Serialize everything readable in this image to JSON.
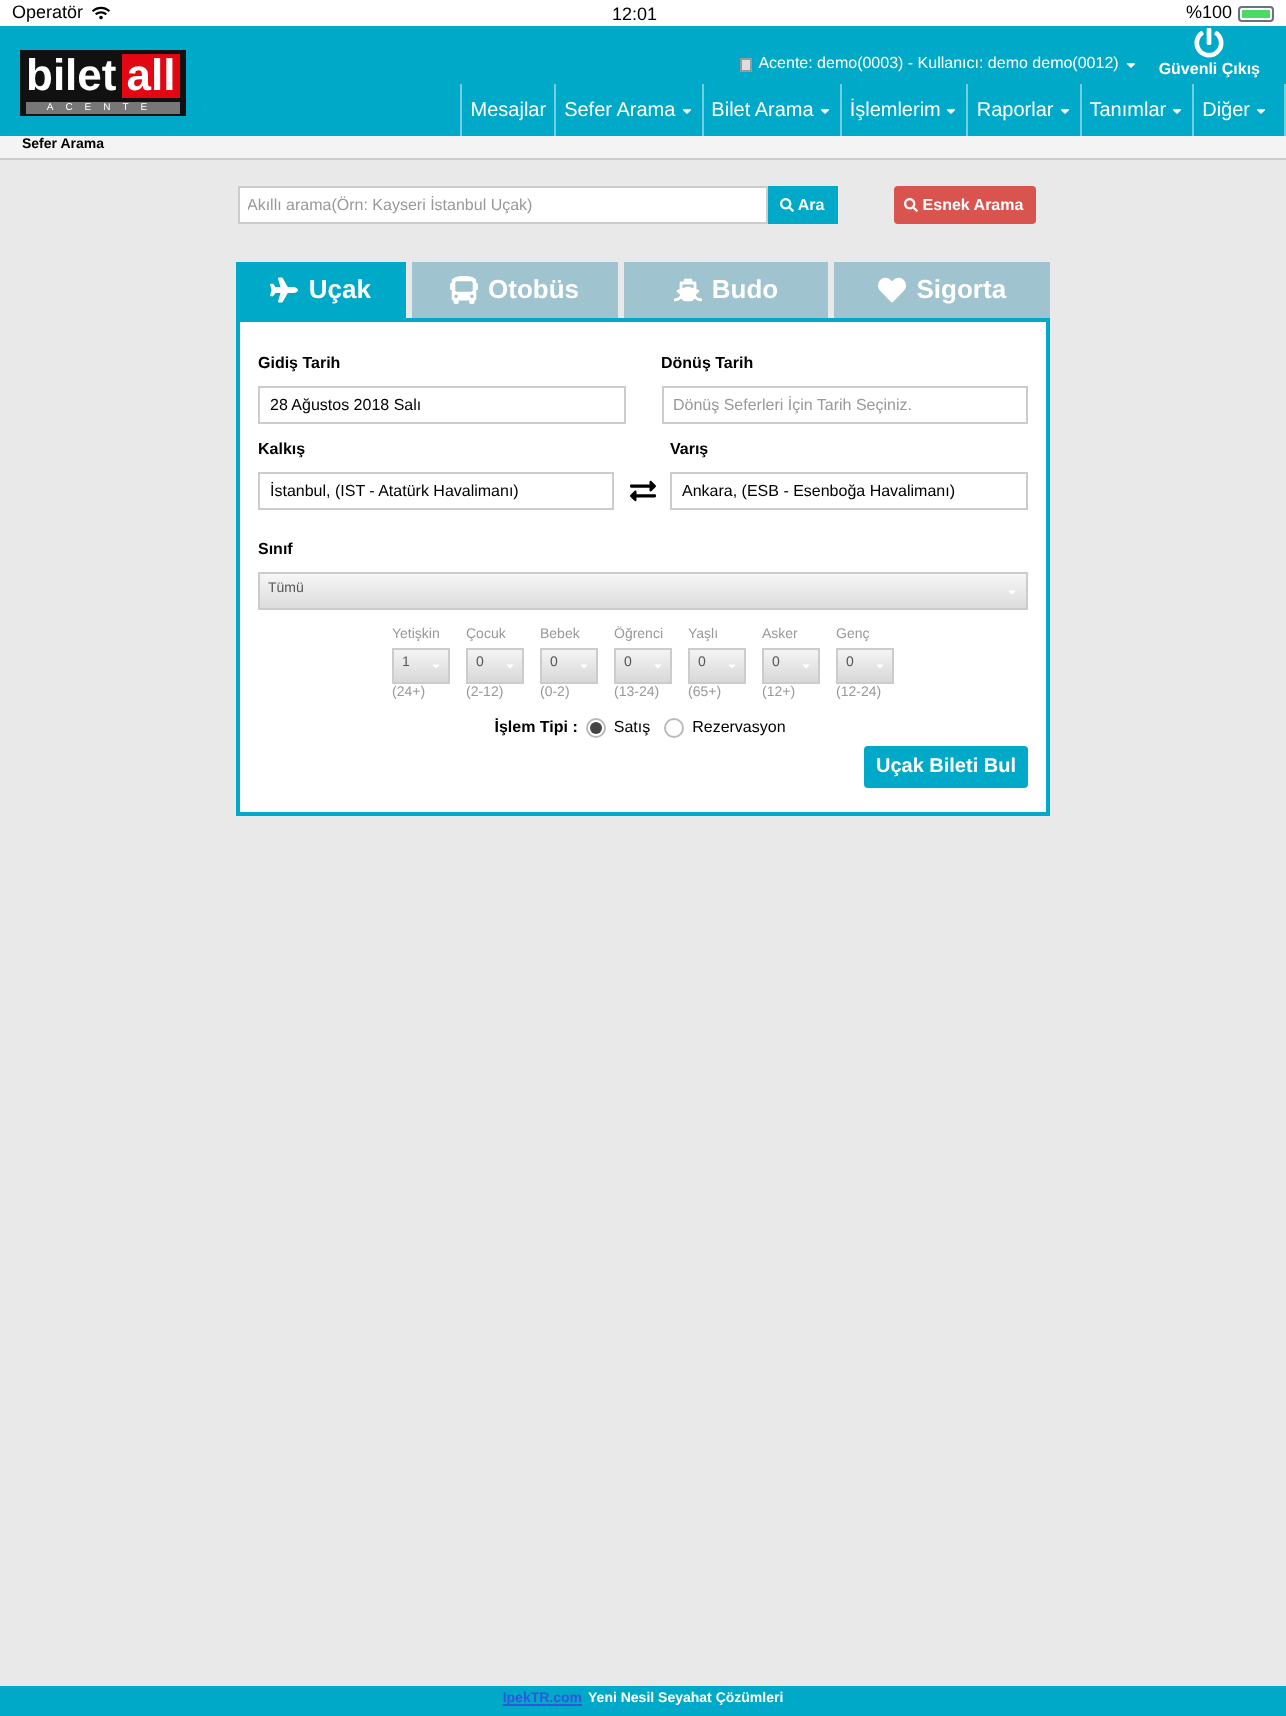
{
  "status_bar": {
    "carrier": "Operatör",
    "time": "12:01",
    "battery": "%100"
  },
  "header": {
    "logo": {
      "left": "bilet",
      "right": "all",
      "sub": "ACENTE"
    },
    "user_info": "Acente: demo(0003) - Kullanıcı: demo demo(0012)",
    "logout": "Güvenli Çıkış",
    "nav": [
      {
        "label": "Mesajlar",
        "dropdown": false
      },
      {
        "label": "Sefer Arama",
        "dropdown": true
      },
      {
        "label": "Bilet Arama",
        "dropdown": true
      },
      {
        "label": "İşlemlerim",
        "dropdown": true
      },
      {
        "label": "Raporlar",
        "dropdown": true
      },
      {
        "label": "Tanımlar",
        "dropdown": true
      },
      {
        "label": "Diğer",
        "dropdown": true
      }
    ]
  },
  "breadcrumb": "Sefer Arama",
  "search": {
    "placeholder": "Akıllı arama(Örn: Kayseri İstanbul Uçak)",
    "button": "Ara",
    "flex_button": "Esnek Arama"
  },
  "tabs": [
    {
      "label": "Uçak",
      "kind": "plane",
      "selected": true
    },
    {
      "label": "Otobüs",
      "kind": "bus",
      "selected": false
    },
    {
      "label": "Budo",
      "kind": "ship",
      "selected": false
    },
    {
      "label": "Sigorta",
      "kind": "heart",
      "selected": false
    }
  ],
  "form": {
    "departure_date": {
      "label": "Gidiş Tarih",
      "value": "28 Ağustos 2018 Salı"
    },
    "return_date": {
      "label": "Dönüş Tarih",
      "placeholder": "Dönüş Seferleri İçin Tarih Seçiniz."
    },
    "from": {
      "label": "Kalkış",
      "value": "İstanbul, (IST - Atatürk Havalimanı)"
    },
    "to": {
      "label": "Varış",
      "value": "Ankara, (ESB - Esenboğa Havalimanı)"
    },
    "class": {
      "label": "Sınıf",
      "value": "Tümü"
    },
    "passengers": [
      {
        "label": "Yetişkin",
        "value": "1",
        "range": "(24+)"
      },
      {
        "label": "Çocuk",
        "value": "0",
        "range": "(2-12)"
      },
      {
        "label": "Bebek",
        "value": "0",
        "range": "(0-2)"
      },
      {
        "label": "Öğrenci",
        "value": "0",
        "range": "(13-24)"
      },
      {
        "label": "Yaşlı",
        "value": "0",
        "range": "(65+)"
      },
      {
        "label": "Asker",
        "value": "0",
        "range": "(12+)"
      },
      {
        "label": "Genç",
        "value": "0",
        "range": "(12-24)"
      }
    ],
    "transaction_type": {
      "label": "İşlem Tipi :",
      "options": [
        {
          "label": "Satış",
          "selected": true
        },
        {
          "label": "Rezervasyon",
          "selected": false
        }
      ]
    },
    "submit": "Uçak Bileti Bul"
  },
  "footer": {
    "link": "IpekTR.com",
    "text": "Yeni Nesil Seyahat Çözümleri"
  }
}
